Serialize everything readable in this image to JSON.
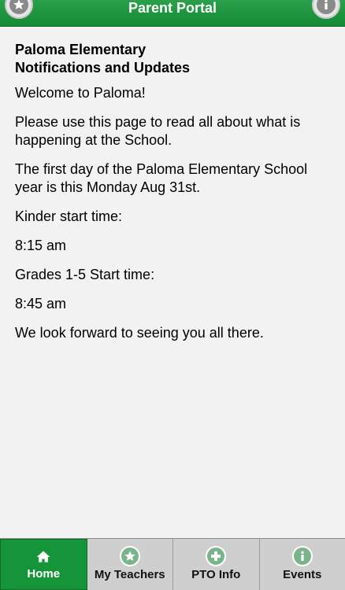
{
  "header": {
    "title": "Parent Portal",
    "left_icon": "star-icon",
    "right_icon": "info-icon"
  },
  "content": {
    "heading_line1": "Paloma Elementary",
    "heading_line2": "Notifications and Updates",
    "paragraphs": [
      "Welcome to Paloma!",
      "Please use this page to read all about what is happening at the School.",
      "The first day of the Paloma Elementary School year is this Monday Aug 31st.",
      "Kinder start time:",
      "8:15 am",
      "Grades 1-5 Start time:",
      "8:45 am",
      "We look forward to seeing you all there."
    ]
  },
  "tabs": [
    {
      "label": "Home",
      "icon": "home-icon",
      "active": true
    },
    {
      "label": "My Teachers",
      "icon": "star-icon",
      "active": false
    },
    {
      "label": "PTO Info",
      "icon": "plus-icon",
      "active": false
    },
    {
      "label": "Events",
      "icon": "info-icon",
      "active": false
    }
  ],
  "colors": {
    "brand_green": "#168a35",
    "tab_inactive": "#cfcfcf",
    "page_bg": "#f2f2f2"
  }
}
